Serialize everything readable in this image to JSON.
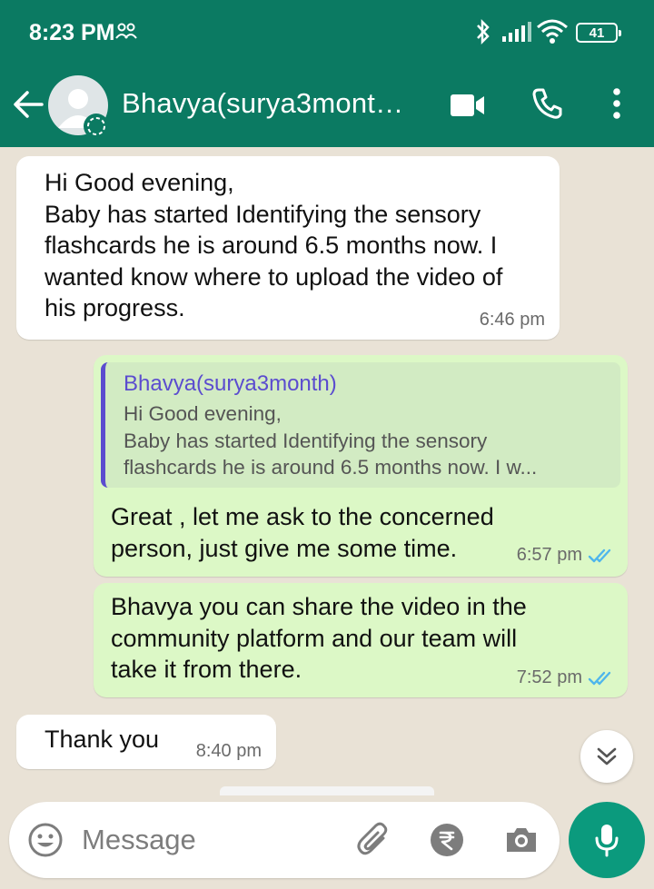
{
  "status_bar": {
    "time": "8:23 PM",
    "battery": "41"
  },
  "header": {
    "contact_name": "Bhavya(surya3mont…"
  },
  "messages": [
    {
      "direction": "incoming",
      "text": "Hi Good evening,\nBaby has started Identifying the sensory\nflashcards he is around 6.5 months now. I\nwanted know where to upload the video of\nhis progress.",
      "time": "6:46 pm"
    },
    {
      "direction": "outgoing",
      "quote_author": "Bhavya(surya3month)",
      "quote_text": "Hi Good evening,\nBaby has started Identifying the sensory\nflashcards he is around 6.5 months now. I w...",
      "text": "Great , let me ask to the concerned\nperson, just give me some time.",
      "time": "6:57 pm",
      "status": "read"
    },
    {
      "direction": "outgoing",
      "text": "Bhavya you can share the video in the\ncommunity platform and our team will\ntake it from there.",
      "time": "7:52 pm",
      "status": "read"
    },
    {
      "direction": "incoming",
      "text": "Thank you",
      "time": "8:40 pm"
    }
  ],
  "input": {
    "placeholder": "Message"
  },
  "colors": {
    "header": "#0b7a62",
    "outgoing_bubble": "#dcf8c6",
    "incoming_bubble": "#ffffff",
    "read_ticks": "#4fb6ec",
    "quote_accent": "#5b4ccf",
    "mic_button": "#0b9a7d"
  }
}
